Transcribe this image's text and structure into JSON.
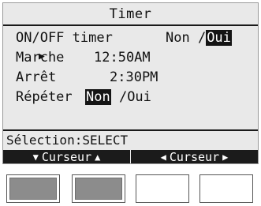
{
  "screen": {
    "title": "Timer",
    "rows": [
      {
        "cursor": "▶",
        "label": "ON/OFF timer",
        "value_plain": "Non /",
        "value_selected": "Oui"
      },
      {
        "cursor": "",
        "label": "Marche",
        "value": "12:50AM"
      },
      {
        "cursor": "",
        "label": "Arrêt",
        "value": "2:30PM"
      },
      {
        "cursor": "",
        "label": "Répéter",
        "value_selected": "Non",
        "value_plain": " /Oui"
      }
    ],
    "status": "Sélection:SELECT",
    "softkeys": [
      {
        "left_icon": "▼",
        "label": "Curseur",
        "right_icon": "▲"
      },
      {
        "left_icon": "◀",
        "label": "Curseur",
        "right_icon": "▶"
      }
    ]
  },
  "hardware_buttons": [
    {
      "name": "F1",
      "pressed": true
    },
    {
      "name": "F2",
      "pressed": true
    },
    {
      "name": "F3",
      "pressed": false
    },
    {
      "name": "F4",
      "pressed": false
    }
  ],
  "colors": {
    "lcd_background": "#e9e9e9",
    "lcd_ink": "#111111",
    "button_pressed": "#8c8c8c"
  }
}
